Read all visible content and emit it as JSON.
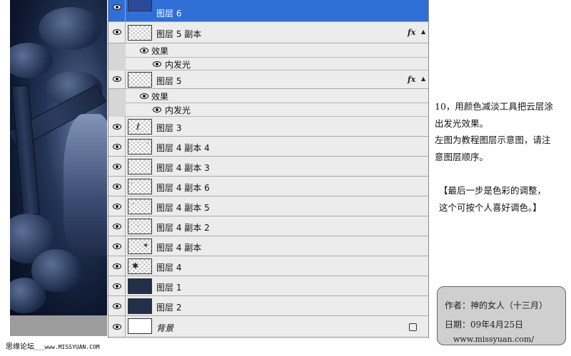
{
  "layers": [
    {
      "name": "图层 6",
      "thumb": "blue",
      "selected": true
    },
    {
      "name": "图层 5 副本",
      "thumb": "checker",
      "fx": "fx",
      "effects_label": "效果",
      "effect": "内发光"
    },
    {
      "name": "图层 5",
      "thumb": "checker",
      "fx": "fx",
      "effects_label": "效果",
      "effect": "内发光"
    },
    {
      "name": "图层 3",
      "thumb": "checker"
    },
    {
      "name": "图层 4 副本 4",
      "thumb": "checker"
    },
    {
      "name": "图层 4 副本 3",
      "thumb": "checker"
    },
    {
      "name": "图层 4 副本 6",
      "thumb": "checker"
    },
    {
      "name": "图层 4 副本 5",
      "thumb": "checker"
    },
    {
      "name": "图层 4 副本 2",
      "thumb": "checker"
    },
    {
      "name": "图层 4 副本",
      "thumb": "checker"
    },
    {
      "name": "图层 4",
      "thumb": "checker"
    },
    {
      "name": "图层 1",
      "thumb": "dark"
    },
    {
      "name": "图层 2",
      "thumb": "dark"
    },
    {
      "name": "背景",
      "thumb": "white",
      "locked": true
    }
  ],
  "note": {
    "line1": "10，用颜色减淡工具把云层涂",
    "line2": "出发光效果。",
    "line3": "左图为教程图层示意图，请注",
    "line4": "意图层顺序。",
    "line5": "【最后一步是色彩的调整，",
    "line6": " 这个可按个人喜好调色。】"
  },
  "credit": {
    "author": "作者：神的女人（十三月）",
    "date": "日期：09年4月25日",
    "site": "www.missyuan.com/"
  },
  "footer": {
    "forum": "思缘论坛",
    "site": "www.MISSYUAN.COM"
  },
  "colors": {
    "selection": "#2f6fd6",
    "panel": "#ececec"
  }
}
